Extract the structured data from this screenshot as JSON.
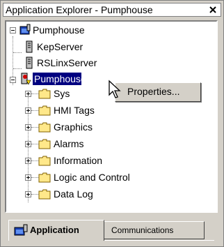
{
  "window": {
    "title": "Application Explorer - Pumphouse"
  },
  "tree": {
    "root_label": "Pumphouse",
    "servers": [
      {
        "label": "KepServer"
      },
      {
        "label": "RSLinxServer"
      }
    ],
    "project_label": "Pumphouse",
    "children": [
      {
        "label": "Sys"
      },
      {
        "label": "HMI Tags"
      },
      {
        "label": "Graphics"
      },
      {
        "label": "Alarms"
      },
      {
        "label": "Information"
      },
      {
        "label": "Logic and Control"
      },
      {
        "label": "Data Log"
      }
    ]
  },
  "context_menu": {
    "items": [
      {
        "label": "Properties..."
      }
    ]
  },
  "tabs": [
    {
      "label": "Application",
      "active": true
    },
    {
      "label": "Communications",
      "active": false
    }
  ],
  "colors": {
    "selection": "#000080",
    "folder": "#ffe88a",
    "face": "#d4d0c8"
  }
}
